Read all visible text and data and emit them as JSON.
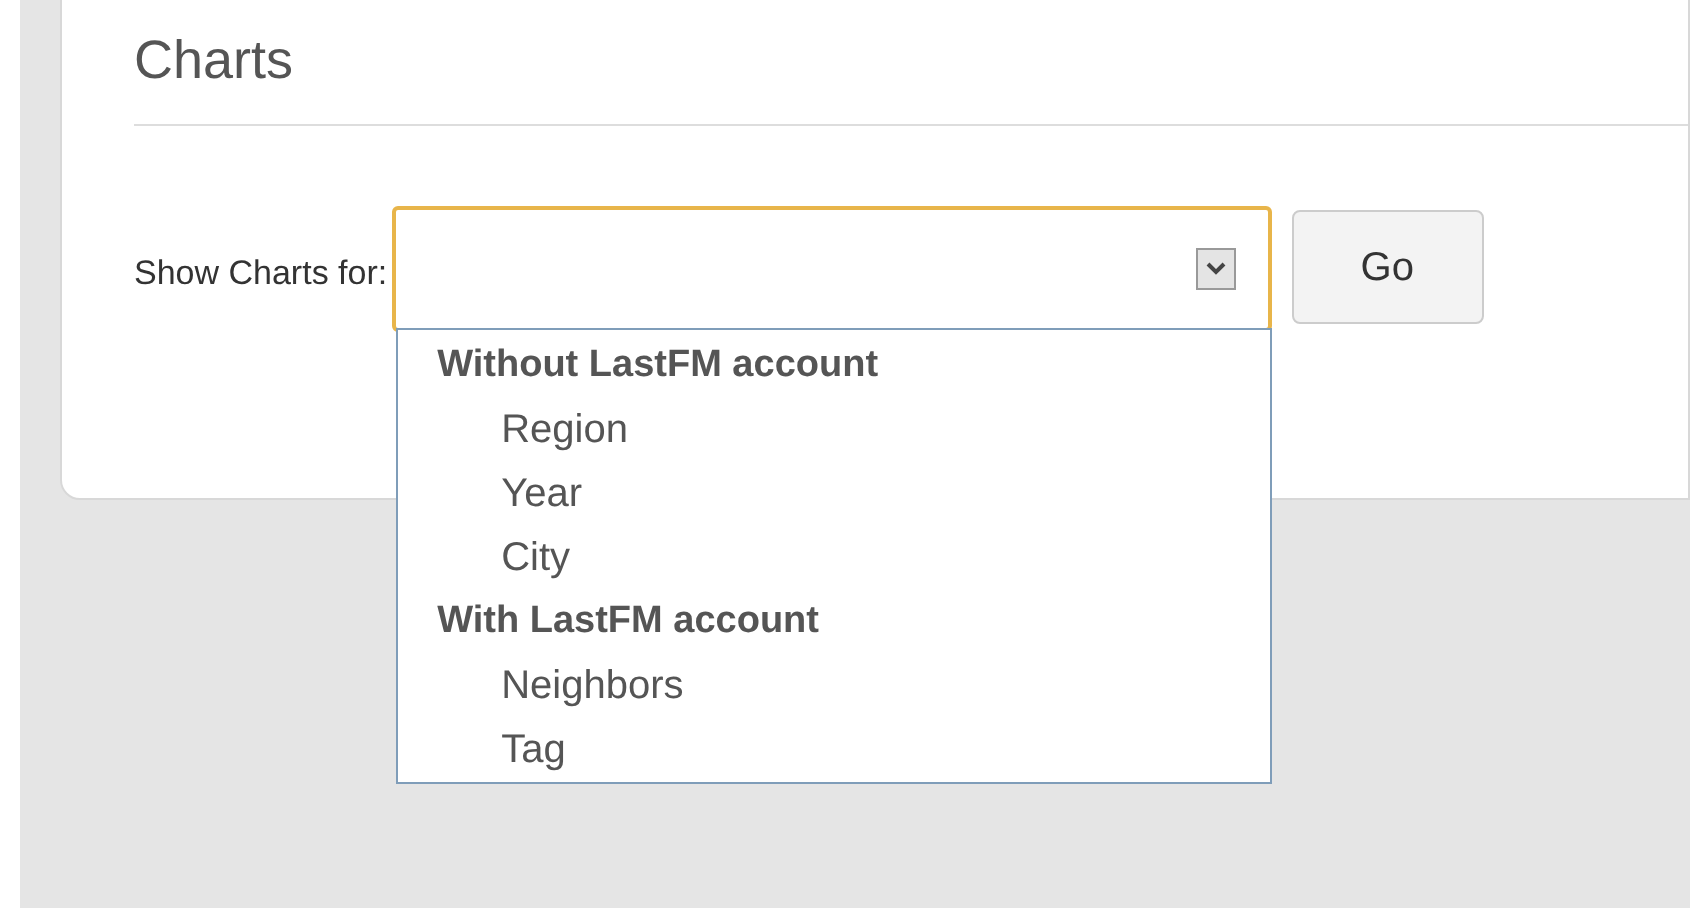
{
  "title": "Charts",
  "form": {
    "label": "Show Charts for:",
    "select": {
      "expanded": true,
      "groups": [
        {
          "label": "Without LastFM account",
          "options": [
            "Region",
            "Year",
            "City"
          ]
        },
        {
          "label": "With LastFM account",
          "options": [
            "Neighbors",
            "Tag"
          ]
        }
      ]
    },
    "button": "Go"
  }
}
